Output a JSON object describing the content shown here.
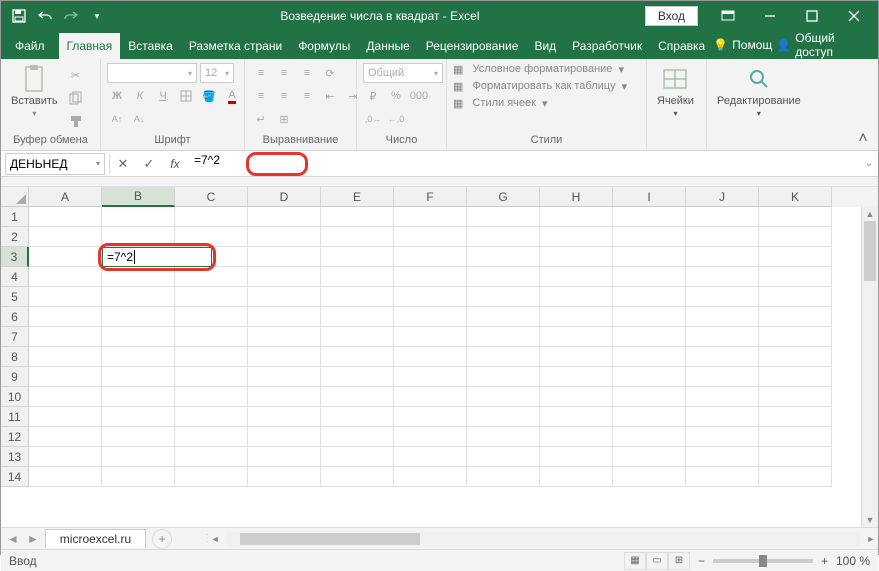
{
  "title": "Возведение числа в квадрат  -  Excel",
  "signin": "Вход",
  "tabs": {
    "file": "Файл",
    "home": "Главная",
    "insert": "Вставка",
    "layout": "Разметка страни",
    "formulas": "Формулы",
    "data": "Данные",
    "review": "Рецензирование",
    "view": "Вид",
    "developer": "Разработчик",
    "help": "Справка"
  },
  "tell_me": "Помощ",
  "share": "Общий доступ",
  "ribbon": {
    "paste": "Вставить",
    "clipboard": "Буфер обмена",
    "font_group": "Шрифт",
    "font_size": "12",
    "align": "Выравнивание",
    "number_group": "Число",
    "number_format": "Общий",
    "styles": "Стили",
    "cond_format": "Условное форматирование",
    "format_table": "Форматировать как таблицу",
    "cell_styles": "Стили ячеек",
    "cells": "Ячейки",
    "editing": "Редактирование"
  },
  "namebox": "ДЕНЬНЕД",
  "formula": "=7^2",
  "cell_value": "=7^2",
  "columns": [
    "A",
    "B",
    "C",
    "D",
    "E",
    "F",
    "G",
    "H",
    "I",
    "J",
    "K"
  ],
  "rows": [
    "1",
    "2",
    "3",
    "4",
    "5",
    "6",
    "7",
    "8",
    "9",
    "10",
    "11",
    "12",
    "13",
    "14"
  ],
  "active_col": "B",
  "active_row": "3",
  "sheet": "microexcel.ru",
  "status": "Ввод",
  "zoom": "100 %"
}
